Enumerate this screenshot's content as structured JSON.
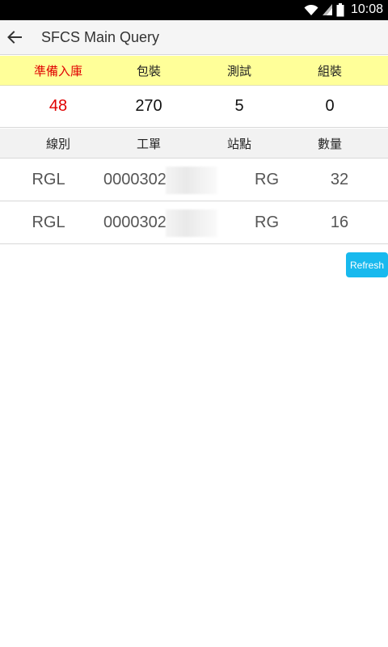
{
  "status_bar": {
    "time": "10:08",
    "icons": [
      "wifi-icon",
      "signal-icon",
      "battery-icon"
    ]
  },
  "app_bar": {
    "title": "SFCS Main Query",
    "back_icon": "arrow-back-icon"
  },
  "summary": {
    "headers": [
      "準備入庫",
      "包裝",
      "測試",
      "組裝"
    ],
    "values": [
      "48",
      "270",
      "5",
      "0"
    ],
    "highlight_color": "#e00000",
    "header_bg": "#ffff99"
  },
  "details": {
    "headers": [
      "線別",
      "工單",
      "站點",
      "數量"
    ],
    "rows": [
      {
        "line": "RGL",
        "order": "0000302",
        "station": "RG",
        "qty": "32"
      },
      {
        "line": "RGL",
        "order": "0000302",
        "station": "RG",
        "qty": "16"
      }
    ]
  },
  "refresh_button": {
    "label": "Refresh",
    "color": "#18b9ee"
  }
}
